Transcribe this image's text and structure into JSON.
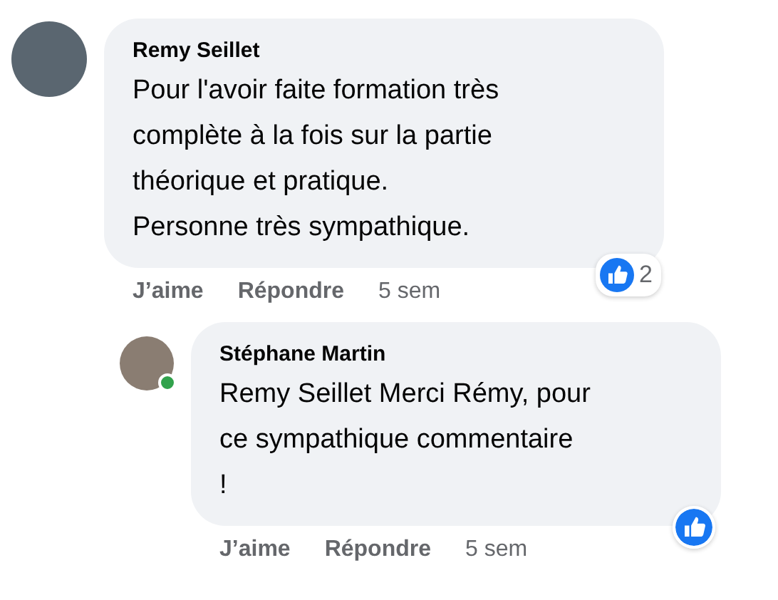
{
  "comments": [
    {
      "author": "Remy Seillet",
      "online": false,
      "text": "Pour l'avoir faite formation très\ncomplète à la fois sur la partie\nthéorique et pratique.\nPersonne très sympathique.",
      "reaction_count": "2",
      "actions": [
        "J’aime",
        "Répondre"
      ],
      "time": "5 sem",
      "children": [
        {
          "author": "Stéphane Martin",
          "online": true,
          "text": "Remy Seillet Merci Rémy, pour\nce sympathique commentaire\n!",
          "actions": [
            "J’aime",
            "Répondre"
          ],
          "time": "5 sem"
        }
      ]
    }
  ]
}
